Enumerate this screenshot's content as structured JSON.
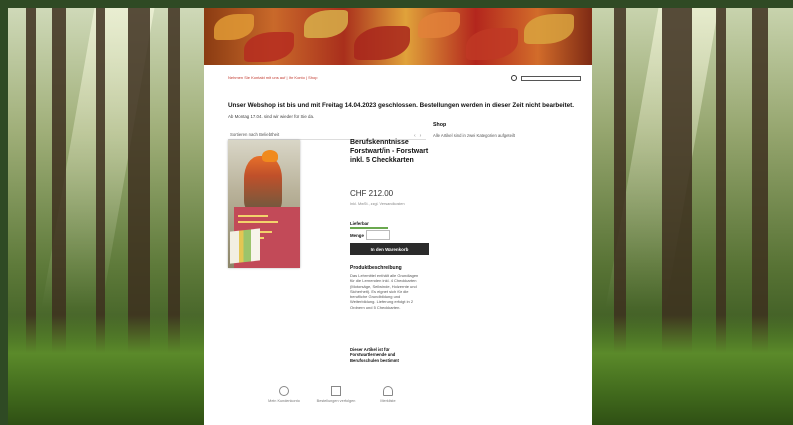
{
  "nav": {
    "top_links": "Nehmen Sie Kontakt mit uns auf  |  Ihr Konto  |  Shop",
    "accent": "#c23a2f"
  },
  "notice": {
    "bold": "Unser Webshop ist bis und mit Freitag 14.04.2023 geschlossen. Bestellungen werden in dieser Zeit nicht bearbeitet.",
    "small": "Ab Montag 17.04. sind wir wieder für Sie da."
  },
  "shop": {
    "title": "Shop",
    "description": "Alle Artikel sind in zwei Kategorien aufgeteilt",
    "sort_label": "Sortieren nach Beliebtheit",
    "pager_prev": "‹",
    "pager_next": "›"
  },
  "product": {
    "title": "Berufskenntnisse Forstwart/in - Forstwart inkl. 5 Checkkarten",
    "price": "CHF 212.00",
    "price_note": "Inkl. MwSt., zzgl. Versandkosten",
    "delivery_label": "Lieferbar",
    "qty_label": "Menge",
    "cart_button": "In den Warenkorb",
    "desc_title": "Produktbeschreibung",
    "desc_text": "Das Lehrmittel enthält alle Grundlagen für die Lernenden inkl. 4 Checkkarten (Motorsäge, Seilwinde, Holzernte und Sicherheit). Es eignet sich für die berufliche Grundbildung und Weiterbildung. Lieferung erfolgt in 2 Ordnern und 5 Checkkarten.",
    "desc_bold": "Dieser Artikel ist für Forstwartlernende und Berufsschulen bestimmt"
  },
  "footer": {
    "items": [
      {
        "label": "Mein Kundenkonto",
        "icon": "user-icon"
      },
      {
        "label": "Bestellungen verfolgen",
        "icon": "box-icon"
      },
      {
        "label": "Merkliste",
        "icon": "bell-icon"
      }
    ]
  }
}
